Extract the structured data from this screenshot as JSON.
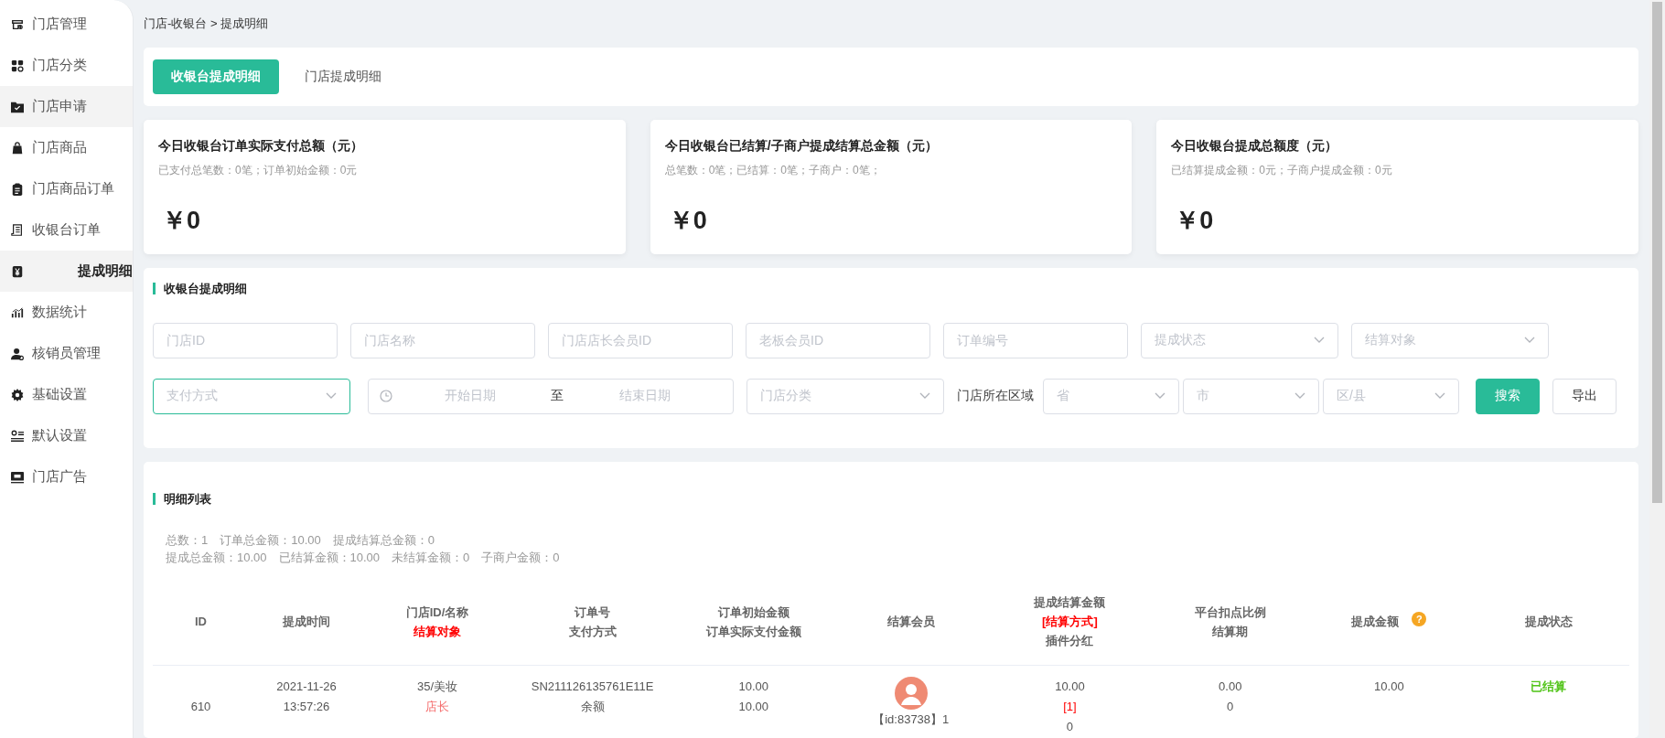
{
  "sidebar": {
    "items": [
      {
        "label": "门店管理",
        "selected": false,
        "hovered": false
      },
      {
        "label": "门店分类",
        "selected": false,
        "hovered": false
      },
      {
        "label": "门店申请",
        "selected": false,
        "hovered": true
      },
      {
        "label": "门店商品",
        "selected": false,
        "hovered": false
      },
      {
        "label": "门店商品订单",
        "selected": false,
        "hovered": false
      },
      {
        "label": "收银台订单",
        "selected": false,
        "hovered": false
      },
      {
        "label": "提成明细",
        "selected": true,
        "hovered": false
      },
      {
        "label": "数据统计",
        "selected": false,
        "hovered": false
      },
      {
        "label": "核销员管理",
        "selected": false,
        "hovered": false
      },
      {
        "label": "基础设置",
        "selected": false,
        "hovered": false
      },
      {
        "label": "默认设置",
        "selected": false,
        "hovered": false
      },
      {
        "label": "门店广告",
        "selected": false,
        "hovered": false
      }
    ]
  },
  "breadcrumb": "门店-收银台 > 提成明细",
  "tabs": [
    {
      "label": "收银台提成明细",
      "selected": true
    },
    {
      "label": "门店提成明细",
      "selected": false
    }
  ],
  "stat_cards": [
    {
      "title": "今日收银台订单实际支付总额（元）",
      "subtitle": "已支付总笔数：0笔；订单初始金额：0元",
      "value": "￥0"
    },
    {
      "title": "今日收银台已结算/子商户提成结算总金额（元）",
      "subtitle": "总笔数：0笔；已结算：0笔；子商户：0笔；",
      "value": "￥0"
    },
    {
      "title": "今日收银台提成总额度（元）",
      "subtitle": "已结算提成金额：0元；子商户提成金额：0元",
      "value": "￥0"
    }
  ],
  "filter_panel": {
    "title": "收银台提成明细",
    "first_row": [
      {
        "kind": "input",
        "placeholder": "门店ID",
        "focused": false
      },
      {
        "kind": "input",
        "placeholder": "门店名称",
        "focused": false
      },
      {
        "kind": "input",
        "placeholder": "门店店长会员ID",
        "focused": false
      },
      {
        "kind": "input",
        "placeholder": "老板会员ID",
        "focused": false
      },
      {
        "kind": "input",
        "placeholder": "订单编号",
        "focused": false
      },
      {
        "kind": "select",
        "placeholder": "提成状态",
        "focused": false
      },
      {
        "kind": "select",
        "placeholder": "结算对象",
        "focused": false
      }
    ],
    "second_row": [
      {
        "kind": "select",
        "placeholder": "支付方式",
        "focused": true
      },
      {
        "kind": "daterange",
        "start_placeholder": "开始日期",
        "separator": "至",
        "end_placeholder": "结束日期"
      },
      {
        "kind": "select",
        "placeholder": "门店分类",
        "focused": false
      },
      {
        "kind": "label",
        "text": "门店所在区域"
      },
      {
        "kind": "small-select",
        "placeholder": "省",
        "focused": false
      },
      {
        "kind": "small-select",
        "placeholder": "市",
        "focused": false
      },
      {
        "kind": "small-select",
        "placeholder": "区/县",
        "focused": false
      },
      {
        "kind": "primary-button",
        "text": "搜索"
      },
      {
        "kind": "button",
        "text": "导出"
      }
    ]
  },
  "list_panel": {
    "title": "明细列表",
    "summary": [
      "总数：1　订单总金额：10.00　提成结算总金额：0",
      "提成总金额：10.00　已结算金额：10.00　未结算金额：0　子商户金额：0"
    ],
    "table": {
      "columns": [
        {
          "lines": [
            {
              "text": "ID",
              "kind": "normal"
            }
          ],
          "help": false
        },
        {
          "lines": [
            {
              "text": "提成时间",
              "kind": "normal"
            }
          ],
          "help": false
        },
        {
          "lines": [
            {
              "text": "门店ID/名称",
              "kind": "normal"
            },
            {
              "text": "结算对象",
              "kind": "red"
            }
          ],
          "help": false
        },
        {
          "lines": [
            {
              "text": "订单号",
              "kind": "normal"
            },
            {
              "text": "支付方式",
              "kind": "normal"
            }
          ],
          "help": false
        },
        {
          "lines": [
            {
              "text": "订单初始金额",
              "kind": "normal"
            },
            {
              "text": "订单实际支付金额",
              "kind": "normal"
            }
          ],
          "help": false
        },
        {
          "lines": [
            {
              "text": "结算会员",
              "kind": "normal"
            }
          ],
          "help": false
        },
        {
          "lines": [
            {
              "text": "提成结算金额",
              "kind": "normal"
            },
            {
              "text": "[结算方式]",
              "kind": "red"
            },
            {
              "text": "插件分红",
              "kind": "normal"
            }
          ],
          "help": false
        },
        {
          "lines": [
            {
              "text": "平台扣点比例",
              "kind": "normal"
            },
            {
              "text": "结算期",
              "kind": "normal"
            }
          ],
          "help": false
        },
        {
          "lines": [
            {
              "text": "提成金额",
              "kind": "normal"
            }
          ],
          "help": "?"
        },
        {
          "lines": [
            {
              "text": "提成状态",
              "kind": "normal"
            }
          ],
          "help": false
        }
      ],
      "rows": [
        {
          "cells": [
            {
              "lines": [
                {
                  "text": "610",
                  "kind": "normal"
                }
              ],
              "avatar": false
            },
            {
              "lines": [
                {
                  "text": "2021-11-26",
                  "kind": "normal"
                },
                {
                  "text": "13:57:26",
                  "kind": "normal"
                }
              ],
              "avatar": false
            },
            {
              "lines": [
                {
                  "text": "35/美妆",
                  "kind": "normal"
                },
                {
                  "text": "店长",
                  "kind": "red-light"
                }
              ],
              "avatar": false
            },
            {
              "lines": [
                {
                  "text": "SN211126135761E11E",
                  "kind": "normal"
                },
                {
                  "text": "余额",
                  "kind": "normal"
                }
              ],
              "avatar": false
            },
            {
              "lines": [
                {
                  "text": "10.00",
                  "kind": "normal"
                },
                {
                  "text": "10.00",
                  "kind": "normal"
                }
              ],
              "avatar": false
            },
            {
              "lines": [
                {
                  "text": "【id:83738】1",
                  "kind": "normal"
                }
              ],
              "avatar": true
            },
            {
              "lines": [
                {
                  "text": "10.00",
                  "kind": "normal"
                },
                {
                  "text": "[1]",
                  "kind": "red"
                },
                {
                  "text": "0",
                  "kind": "normal"
                }
              ],
              "avatar": false
            },
            {
              "lines": [
                {
                  "text": "0.00",
                  "kind": "normal"
                },
                {
                  "text": "0",
                  "kind": "normal"
                }
              ],
              "avatar": false
            },
            {
              "lines": [
                {
                  "text": "10.00",
                  "kind": "normal"
                }
              ],
              "avatar": false
            },
            {
              "lines": [
                {
                  "text": "已结算",
                  "kind": "green"
                }
              ],
              "avatar": false
            }
          ]
        }
      ]
    }
  }
}
